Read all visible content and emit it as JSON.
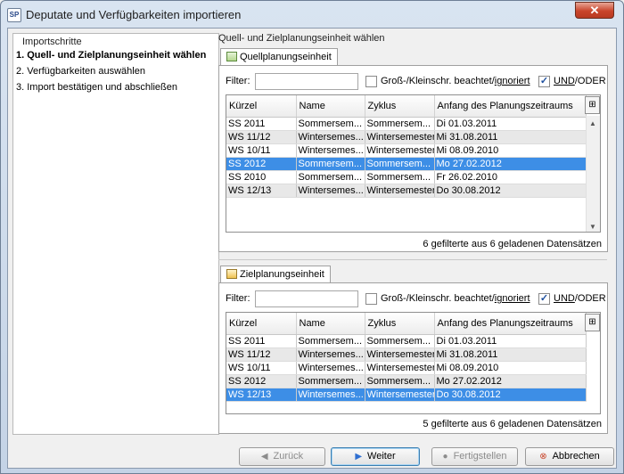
{
  "window": {
    "title": "Deputate und Verfügbarkeiten importieren",
    "app_icon": "SP",
    "close_glyph": "✕"
  },
  "steps": {
    "header": "Importschritte",
    "items": [
      "1. Quell- und Zielplanungseinheit wählen",
      "2. Verfügbarkeiten auswählen",
      "3. Import bestätigen und abschließen"
    ]
  },
  "right_header": "Quell- und Zielplanungseinheit wählen",
  "source": {
    "tab": "Quellplanungseinheit",
    "filter_label": "Filter:",
    "filter_value": "",
    "case_label_a": "Groß-/Kleinschr. beachtet/",
    "case_label_b": "ignoriert",
    "and_label_a": "UND",
    "and_label_b": "/ODER",
    "columns": [
      "Kürzel",
      "Name",
      "Zyklus",
      "Anfang des Planungszeitraums"
    ],
    "rows": [
      [
        "SS 2011",
        "Sommersem...",
        "Sommersem...",
        "Di 01.03.2011"
      ],
      [
        "WS 11/12",
        "Wintersemes...",
        "Wintersemester",
        "Mi 31.08.2011"
      ],
      [
        "WS 10/11",
        "Wintersemes...",
        "Wintersemester",
        "Mi 08.09.2010"
      ],
      [
        "SS 2012",
        "Sommersem...",
        "Sommersem...",
        "Mo 27.02.2012"
      ],
      [
        "SS 2010",
        "Sommersem...",
        "Sommersem...",
        "Fr 26.02.2010"
      ],
      [
        "WS 12/13",
        "Wintersemes...",
        "Wintersemester",
        "Do 30.08.2012"
      ]
    ],
    "selected_row": 3,
    "count": "6 gefilterte aus 6 geladenen Datensätzen"
  },
  "target": {
    "tab": "Zielplanungseinheit",
    "filter_label": "Filter:",
    "filter_value": "",
    "case_label_a": "Groß-/Kleinschr. beachtet/",
    "case_label_b": "ignoriert",
    "and_label_a": "UND",
    "and_label_b": "/ODER",
    "columns": [
      "Kürzel",
      "Name",
      "Zyklus",
      "Anfang des Planungszeitraums"
    ],
    "rows": [
      [
        "SS 2011",
        "Sommersem...",
        "Sommersem...",
        "Di 01.03.2011"
      ],
      [
        "WS 11/12",
        "Wintersemes...",
        "Wintersemester",
        "Mi 31.08.2011"
      ],
      [
        "WS 10/11",
        "Wintersemes...",
        "Wintersemester",
        "Mi 08.09.2010"
      ],
      [
        "SS 2012",
        "Sommersem...",
        "Sommersem...",
        "Mo 27.02.2012"
      ],
      [
        "WS 12/13",
        "Wintersemes...",
        "Wintersemester",
        "Do 30.08.2012"
      ]
    ],
    "selected_row": 4,
    "count": "5 gefilterte aus 6 geladenen Datensätzen"
  },
  "buttons": {
    "back": "Zurück",
    "next": "Weiter",
    "finish": "Fertigstellen",
    "cancel": "Abbrechen"
  },
  "colors": {
    "selection": "#3d8ee6",
    "close": "#c9452b"
  }
}
